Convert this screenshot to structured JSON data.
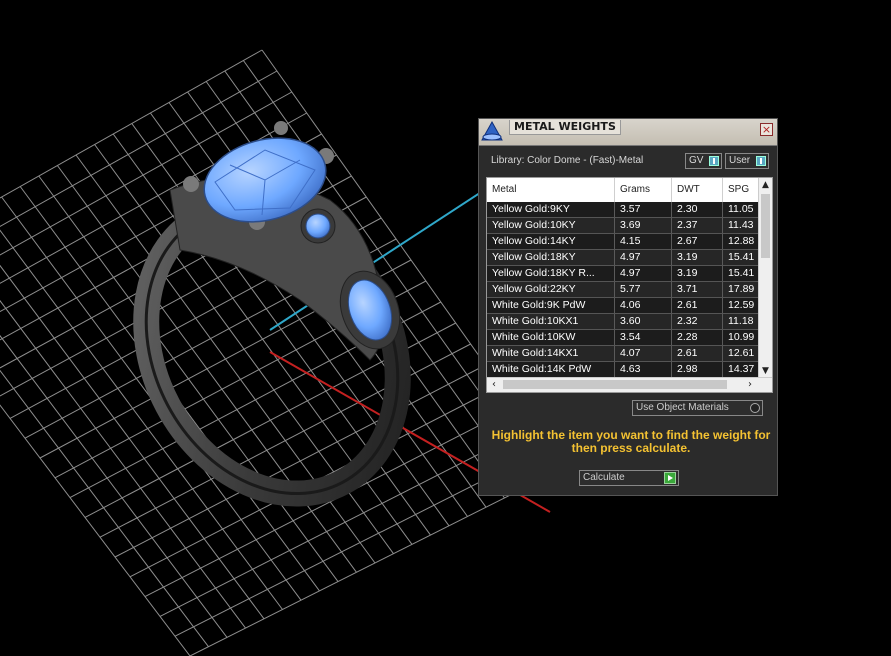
{
  "panel": {
    "title": "METAL WEIGHTS",
    "close_glyph": "×",
    "library_label": "Library: Color Dome - (Fast)-Metal",
    "toggles": [
      {
        "label": "GV"
      },
      {
        "label": "User"
      }
    ],
    "table": {
      "headers": [
        "Metal",
        "Grams",
        "DWT",
        "SPG"
      ],
      "rows": [
        [
          "Yellow Gold:9KY",
          "3.57",
          "2.30",
          "11.05"
        ],
        [
          "Yellow Gold:10KY",
          "3.69",
          "2.37",
          "11.43"
        ],
        [
          "Yellow Gold:14KY",
          "4.15",
          "2.67",
          "12.88"
        ],
        [
          "Yellow Gold:18KY",
          "4.97",
          "3.19",
          "15.41"
        ],
        [
          "Yellow Gold:18KY R...",
          "4.97",
          "3.19",
          "15.41"
        ],
        [
          "Yellow Gold:22KY",
          "5.77",
          "3.71",
          "17.89"
        ],
        [
          "White Gold:9K PdW",
          "4.06",
          "2.61",
          "12.59"
        ],
        [
          "White Gold:10KX1",
          "3.60",
          "2.32",
          "11.18"
        ],
        [
          "White Gold:10KW",
          "3.54",
          "2.28",
          "10.99"
        ],
        [
          "White Gold:14KX1",
          "4.07",
          "2.61",
          "12.61"
        ],
        [
          "White Gold:14K PdW",
          "4.63",
          "2.98",
          "14.37"
        ]
      ]
    },
    "use_object_materials_label": "Use Object Materials",
    "hint": "Highlight the item you want to find the weight for then press calculate.",
    "calculate_label": "Calculate"
  },
  "icons": [
    "app-logo-icon",
    "close-icon",
    "toggle-icon",
    "scroll-up-icon",
    "scroll-down-icon",
    "scroll-left-icon",
    "scroll-right-icon",
    "play-icon"
  ],
  "colors": {
    "hint": "#f4c232",
    "grid": "#9a9a9a",
    "gem": "#6ea8ff",
    "metal": "#3c3c3c"
  }
}
